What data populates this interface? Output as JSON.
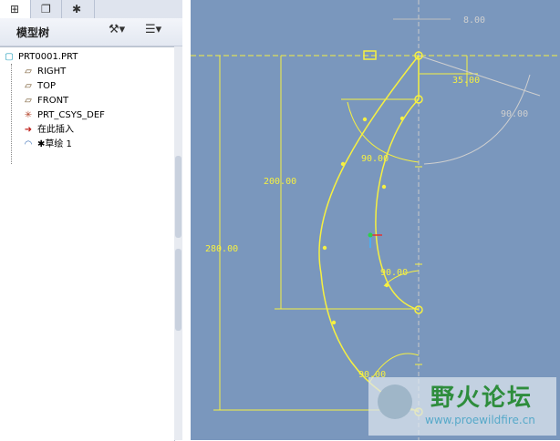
{
  "tabs": [
    {
      "icon": "tree-icon",
      "glyph": "⊞"
    },
    {
      "icon": "layers-icon",
      "glyph": "❐"
    },
    {
      "icon": "star-folder-icon",
      "glyph": "✱"
    }
  ],
  "panel": {
    "title": "模型树"
  },
  "tree": {
    "items": [
      {
        "label": "PRT0001.PRT",
        "icon": "part-icon",
        "glyph": "▢"
      },
      {
        "label": "RIGHT",
        "icon": "datum-plane-icon",
        "glyph": "▱"
      },
      {
        "label": "TOP",
        "icon": "datum-plane-icon",
        "glyph": "▱"
      },
      {
        "label": "FRONT",
        "icon": "datum-plane-icon",
        "glyph": "▱"
      },
      {
        "label": "PRT_CSYS_DEF",
        "icon": "csys-icon",
        "glyph": "✳"
      },
      {
        "label": "在此插入",
        "icon": "insert-arrow-icon",
        "glyph": "➜"
      },
      {
        "label": "✱草绘 1",
        "icon": "sketch-icon",
        "glyph": "◠"
      }
    ]
  },
  "sketch": {
    "dims": {
      "d_top": "8.00",
      "d_35": "35.00",
      "d_angle_right": "90.00",
      "d_angle_upper": "90.00",
      "d_200": "200.00",
      "d_280": "280.00",
      "d_angle_mid": "90.00",
      "d_angle_low": "90.00"
    }
  },
  "watermark": {
    "title": "野火论坛",
    "url": "www.proewildfire.cn"
  },
  "colors": {
    "canvas": "#7a97bd",
    "sketch": "#f6f041"
  }
}
